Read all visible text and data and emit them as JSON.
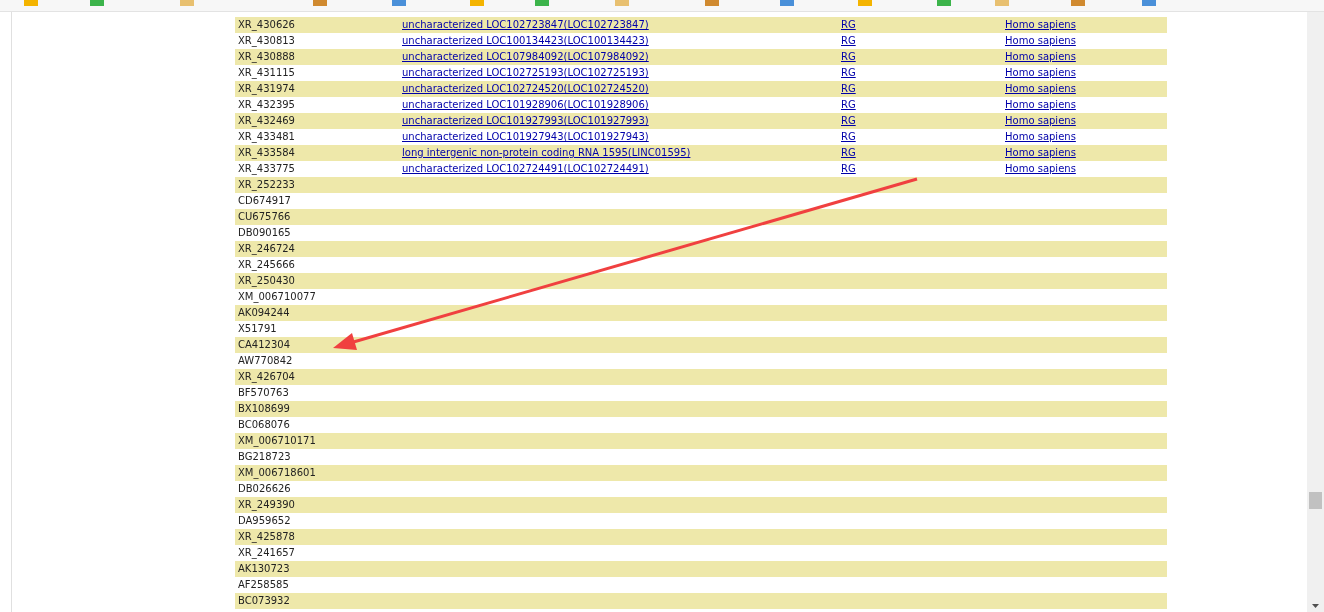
{
  "rows": [
    {
      "column_1": "XR_430626",
      "column_2": "uncharacterized LOC102723847(LOC102723847)",
      "column_3": "RG",
      "column_4": "Homo sapiens"
    },
    {
      "column_1": "XR_430813",
      "column_2": "uncharacterized LOC100134423(LOC100134423)",
      "column_3": "RG",
      "column_4": "Homo sapiens"
    },
    {
      "column_1": "XR_430888",
      "column_2": "uncharacterized LOC107984092(LOC107984092)",
      "column_3": "RG",
      "column_4": "Homo sapiens"
    },
    {
      "column_1": "XR_431115",
      "column_2": "uncharacterized LOC102725193(LOC102725193)",
      "column_3": "RG",
      "column_4": "Homo sapiens"
    },
    {
      "column_1": "XR_431974",
      "column_2": "uncharacterized LOC102724520(LOC102724520)",
      "column_3": "RG",
      "column_4": "Homo sapiens"
    },
    {
      "column_1": "XR_432395",
      "column_2": "uncharacterized LOC101928906(LOC101928906)",
      "column_3": "RG",
      "column_4": "Homo sapiens"
    },
    {
      "column_1": "XR_432469",
      "column_2": "uncharacterized LOC101927993(LOC101927993)",
      "column_3": "RG",
      "column_4": "Homo sapiens"
    },
    {
      "column_1": "XR_433481",
      "column_2": "uncharacterized LOC101927943(LOC101927943)",
      "column_3": "RG",
      "column_4": "Homo sapiens"
    },
    {
      "column_1": "XR_433584",
      "column_2": "long intergenic non-protein coding RNA 1595(LINC01595)",
      "column_3": "RG",
      "column_4": "Homo sapiens"
    },
    {
      "column_1": "XR_433775",
      "column_2": "uncharacterized LOC102724491(LOC102724491)",
      "column_3": "RG",
      "column_4": "Homo sapiens"
    },
    {
      "column_1": "XR_252233"
    },
    {
      "column_1": "CD674917"
    },
    {
      "column_1": "CU675766"
    },
    {
      "column_1": "DB090165"
    },
    {
      "column_1": "XR_246724"
    },
    {
      "column_1": "XR_245666"
    },
    {
      "column_1": "XR_250430"
    },
    {
      "column_1": "XM_006710077"
    },
    {
      "column_1": "AK094244"
    },
    {
      "column_1": "X51791"
    },
    {
      "column_1": "CA412304"
    },
    {
      "column_1": "AW770842"
    },
    {
      "column_1": "XR_426704"
    },
    {
      "column_1": "BF570763"
    },
    {
      "column_1": "BX108699"
    },
    {
      "column_1": "BC068076"
    },
    {
      "column_1": "XM_006710171"
    },
    {
      "column_1": "BG218723"
    },
    {
      "column_1": "XM_006718601"
    },
    {
      "column_1": "DB026626"
    },
    {
      "column_1": "XR_249390"
    },
    {
      "column_1": "DA959652"
    },
    {
      "column_1": "XR_425878"
    },
    {
      "column_1": "XR_241657"
    },
    {
      "column_1": "AK130723"
    },
    {
      "column_1": "AF258585"
    },
    {
      "column_1": "BC073932"
    }
  ]
}
